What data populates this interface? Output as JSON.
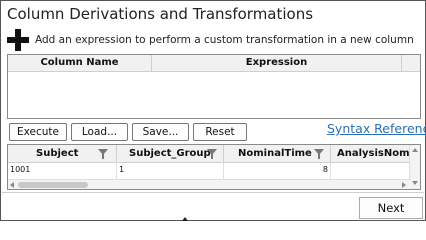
{
  "title": "Column Derivations and Transformations",
  "add_expression": {
    "icon": "plus-icon",
    "label": "Add an expression to perform a custom transformation in a new column"
  },
  "expressions_grid": {
    "columns": [
      "Column Name",
      "Expression"
    ],
    "rows": []
  },
  "buttons": {
    "execute": "Execute",
    "load": "Load...",
    "save": "Save...",
    "reset": "Reset",
    "syntax_reference": "Syntax Reference",
    "next": "Next"
  },
  "data_grid": {
    "columns": [
      "Subject",
      "Subject_Group",
      "NominalTime",
      "AnalysisNomina"
    ],
    "rows": [
      [
        "1001",
        "1",
        "8",
        ""
      ]
    ]
  },
  "colors": {
    "link": "#2b6fb3",
    "border": "#8a8a8a",
    "header_bg": "#f1f1f1"
  }
}
